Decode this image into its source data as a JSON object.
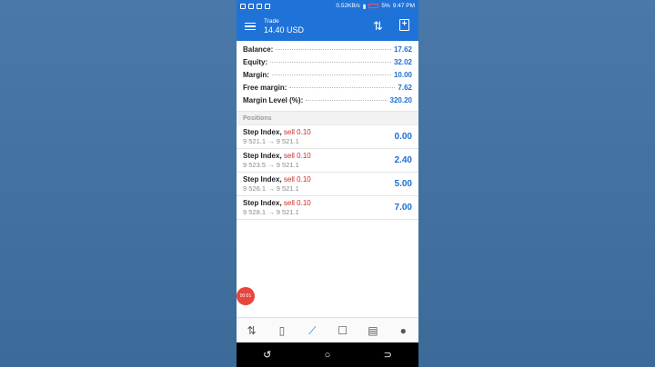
{
  "statusbar": {
    "network": "0.52KB/s",
    "battery": "5%",
    "time": "9:47 PM"
  },
  "toolbar": {
    "small_title": "Trade",
    "big_title": "14.40 USD"
  },
  "summary": [
    {
      "label": "Balance:",
      "value": "17.62"
    },
    {
      "label": "Equity:",
      "value": "32.02"
    },
    {
      "label": "Margin:",
      "value": "10.00"
    },
    {
      "label": "Free margin:",
      "value": "7.62"
    },
    {
      "label": "Margin Level (%):",
      "value": "320.20"
    }
  ],
  "positions_header": "Positions",
  "positions": [
    {
      "symbol": "Step Index,",
      "side": "sell 0.10",
      "open": "9 521.1",
      "current": "9 521.1",
      "profit": "0.00"
    },
    {
      "symbol": "Step Index,",
      "side": "sell 0.10",
      "open": "9 523.5",
      "current": "9 521.1",
      "profit": "2.40"
    },
    {
      "symbol": "Step Index,",
      "side": "sell 0.10",
      "open": "9 526.1",
      "current": "9 521.1",
      "profit": "5.00"
    },
    {
      "symbol": "Step Index,",
      "side": "sell 0.10",
      "open": "9 528.1",
      "current": "9 521.1",
      "profit": "7.00"
    }
  ],
  "rec_timer": "00:01",
  "nav": {
    "quotes_icon": "quotes-icon",
    "chart_icon": "candlestick-icon",
    "trade_icon": "trade-icon",
    "history_icon": "inbox-icon",
    "news_icon": "news-icon",
    "chat_icon": "chat-icon"
  },
  "colors": {
    "accent": "#1f73d8",
    "sell": "#cc2b2b",
    "value": "#1f6fd2"
  }
}
